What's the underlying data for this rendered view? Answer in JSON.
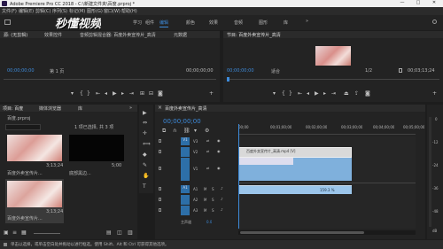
{
  "app": {
    "title": "Adobe Premiere Pro CC 2018 - C:\\新建文件夹\\百度.prproj *",
    "window_controls": [
      "—",
      "□",
      "✕"
    ]
  },
  "menu": [
    "文件(F)",
    "编辑(E)",
    "剪辑(C)",
    "序列(S)",
    "标记(M)",
    "图形(G)",
    "窗口(W)",
    "帮助(H)"
  ],
  "workspaces": [
    "学习",
    "组件",
    "编辑",
    "颜色",
    "效果",
    "音频",
    "图形",
    "库"
  ],
  "workspace_more": "»",
  "watermark": "秒懂视频",
  "source_panel": {
    "tabs": [
      "源: (无剪辑)",
      "效果控件",
      "音频剪辑混合器: 百度外卖宣传片_高清",
      "元数据"
    ],
    "timecode_left": "00;00;00;00",
    "page": "第 1 页",
    "timecode_right": "00;00;00;00"
  },
  "program_panel": {
    "title": "节目: 百度外卖宣传片_高清",
    "timecode_left": "00;00;00;00",
    "fit": "适合",
    "resolution": "1/2",
    "timecode_right": "00;03;13;24"
  },
  "project_panel": {
    "tabs": [
      "项目: 百度",
      "媒体浏览器",
      "库"
    ],
    "file": "百度.prproj",
    "search_placeholder": "",
    "selection_info": "1 项已选择, 共 3 项",
    "items": [
      {
        "name": "百度外卖宣传片...",
        "duration": "3;13;24"
      },
      {
        "name": "底部黑边...",
        "duration": "5;00"
      },
      {
        "name": "百度外卖宣传片...",
        "duration": "3;13;24"
      }
    ]
  },
  "tools": [
    "▶",
    "⇔",
    "✛",
    "⟺",
    "◆",
    "✎",
    "✋",
    "T"
  ],
  "timeline": {
    "tab": "百度外卖宣传片_高清",
    "timecode": "00;00;00;00",
    "ruler": [
      "00;00",
      "00;01;00;00",
      "00;02;00;00",
      "00;03;00;00",
      "00;04;00;00",
      "00;05;00;00"
    ],
    "video_tracks": [
      "V3",
      "V2",
      "V1"
    ],
    "audio_tracks": [
      "A1",
      "A2",
      "A3"
    ],
    "master": "主声道",
    "master_value": "0.0",
    "track_buttons": [
      "M",
      "S"
    ],
    "clip_label": "百度外卖宣传片_高清.mp4 [V]",
    "audio_clip_label": "159.3 %",
    "meter_scale": [
      "0",
      "-12",
      "-24",
      "-36",
      "-48",
      "dB"
    ]
  },
  "status": {
    "text": "单击以选择，或单击空白处并拖动以进行框选。使用 Shift、Alt 和 Ctrl 可获得其他选项。"
  }
}
